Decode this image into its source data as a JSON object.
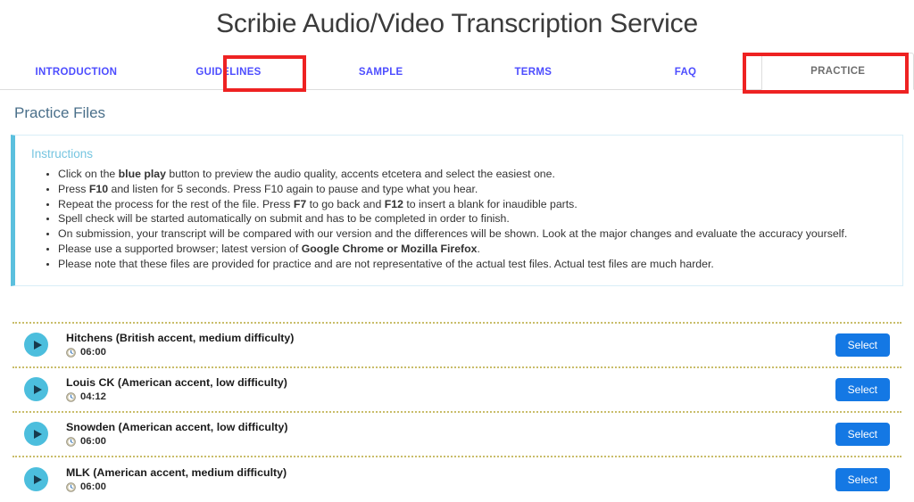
{
  "header": {
    "title": "Scribie Audio/Video Transcription Service"
  },
  "tabs": [
    {
      "label": "INTRODUCTION",
      "active": false
    },
    {
      "label": "GUIDELINES",
      "active": false
    },
    {
      "label": "SAMPLE",
      "active": false
    },
    {
      "label": "TERMS",
      "active": false
    },
    {
      "label": "FAQ",
      "active": false
    },
    {
      "label": "PRACTICE",
      "active": true
    }
  ],
  "annotations": {
    "highlight_color": "#ee2222",
    "boxes": [
      "GUIDELINES",
      "PRACTICE"
    ]
  },
  "main": {
    "section_heading": "Practice Files",
    "instructions": {
      "title": "Instructions",
      "accent_color": "#5bc0de",
      "items": [
        [
          {
            "t": "Click on the "
          },
          {
            "t": "blue play",
            "b": true
          },
          {
            "t": " button to preview the audio quality, accents etcetera and select the easiest one."
          }
        ],
        [
          {
            "t": "Press "
          },
          {
            "t": "F10",
            "b": true
          },
          {
            "t": " and listen for 5 seconds. Press F10 again to pause and type what you hear."
          }
        ],
        [
          {
            "t": "Repeat the process for the rest of the file. Press "
          },
          {
            "t": "F7",
            "b": true
          },
          {
            "t": " to go back and "
          },
          {
            "t": "F12",
            "b": true
          },
          {
            "t": " to insert a blank for inaudible parts."
          }
        ],
        [
          {
            "t": "Spell check will be started automatically on submit and has to be completed in order to finish."
          }
        ],
        [
          {
            "t": "On submission, your transcript will be compared with our version and the differences will be shown. Look at the major changes and evaluate the accuracy yourself."
          }
        ],
        [
          {
            "t": "Please use a supported browser; latest version of "
          },
          {
            "t": "Google Chrome or Mozilla Firefox",
            "b": true
          },
          {
            "t": "."
          }
        ],
        [
          {
            "t": "Please note that these files are provided for practice and are not representative of the actual test files. Actual test files are much harder."
          }
        ]
      ]
    },
    "files": [
      {
        "name": "Hitchens (British accent, medium difficulty)",
        "duration": "06:00",
        "select_label": "Select"
      },
      {
        "name": "Louis CK (American accent, low difficulty)",
        "duration": "04:12",
        "select_label": "Select"
      },
      {
        "name": "Snowden (American accent, low difficulty)",
        "duration": "06:00",
        "select_label": "Select"
      },
      {
        "name": "MLK (American accent, medium difficulty)",
        "duration": "06:00",
        "select_label": "Select"
      }
    ]
  },
  "colors": {
    "tab_link": "#4d4dff",
    "tab_active_text": "#6f6f6f",
    "heading": "#4a6f8a",
    "play_button": "#4cbedd",
    "select_button": "#1478e4",
    "row_divider": "#c9bd6a"
  }
}
